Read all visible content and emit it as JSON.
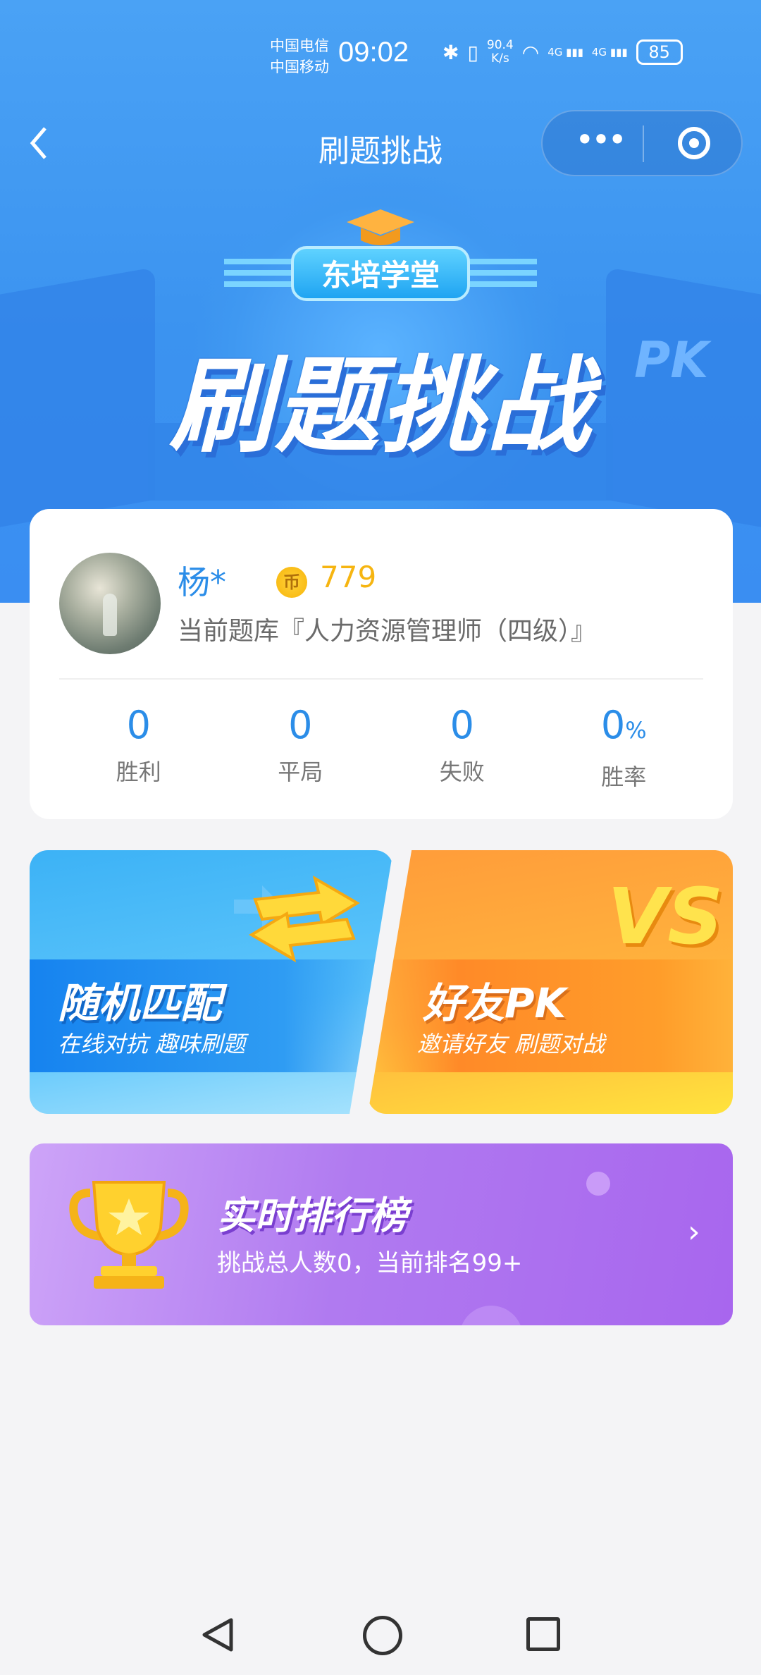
{
  "status_bar": {
    "carrier1": "中国电信",
    "carrier2": "中国移动",
    "time": "09:02",
    "net_speed_value": "90.4",
    "net_speed_unit": "K/s",
    "signal1": "4G",
    "signal2": "4G",
    "battery": "85"
  },
  "nav": {
    "back_icon": "chevron-left",
    "title": "刷题挑战",
    "more_icon": "•••",
    "target_icon": "target-circle"
  },
  "hero": {
    "badge": "东培学堂",
    "title": "刷题挑战",
    "flag_right_text": "PK"
  },
  "profile": {
    "name": "杨*",
    "coin_symbol": "币",
    "coins": "779",
    "bank": "当前题库『人力资源管理师（四级）』",
    "stats": [
      {
        "value": "0",
        "label": "胜利"
      },
      {
        "value": "0",
        "label": "平局"
      },
      {
        "value": "0",
        "label": "失败"
      },
      {
        "value": "0",
        "unit": "%",
        "label": "胜率"
      }
    ]
  },
  "modes": {
    "random": {
      "title": "随机匹配",
      "subtitle": "在线对抗  趣味刷题"
    },
    "friend": {
      "title": "好友PK",
      "subtitle": "邀请好友  刷题对战",
      "vs": "VS"
    }
  },
  "leaderboard": {
    "title": "实时排行榜",
    "subtitle": "挑战总人数0，当前排名99+",
    "chevron": "›"
  },
  "colors": {
    "primary_blue": "#3b93f0",
    "text_blue": "#2b8de8",
    "coin_gold": "#f6b511",
    "purple": "#a866ee",
    "orange": "#ff9c3a"
  }
}
